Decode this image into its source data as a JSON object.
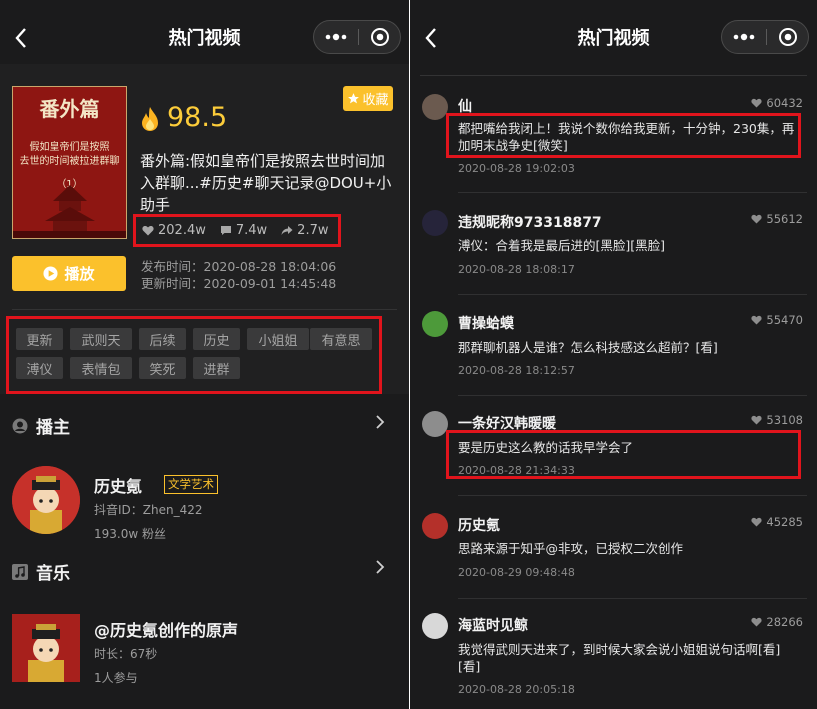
{
  "left": {
    "nav_title": "热门视频",
    "cover_text": {
      "title": "番外篇",
      "line1": "假如皇帝们是按照",
      "line2": "去世的时间被拉进群聊",
      "line3": "（1）"
    },
    "score": "98.5",
    "favorite_label": "收藏",
    "video_title": "番外篇:假如皇帝们是按照去世时间加入群聊...#历史#聊天记录@DOU+小助手",
    "stats": {
      "likes": "202.4w",
      "comments": "7.4w",
      "shares": "2.7w"
    },
    "play_label": "播放",
    "publish_time": "发布时间：2020-08-28 18:04:06",
    "update_time": "更新时间：2020-09-01 14:45:48",
    "tags": [
      "更新",
      "武则天",
      "后续",
      "历史",
      "小姐姐",
      "有意思",
      "溥仪",
      "表情包",
      "笑死",
      "进群"
    ],
    "anchor_section": "播主",
    "anchor": {
      "name": "历史氪",
      "badge": "文学艺术",
      "douyin_id": "抖音ID：Zhen_422",
      "fans": "193.0w 粉丝"
    },
    "music_section": "音乐",
    "music": {
      "title": "@历史氪创作的原声",
      "duration": "时长：67秒",
      "participants": "1人参与"
    }
  },
  "right": {
    "nav_title": "热门视频",
    "comments": [
      {
        "name": "仙",
        "likes": "60432",
        "text": "都把嘴给我闭上！我说个数你给我更新，十分钟，230集，再加明末战争史[微笑]",
        "date": "2020-08-28 19:02:03"
      },
      {
        "name": "违规昵称973318877",
        "likes": "55612",
        "text": "溥仪：合着我是最后进的[黑脸][黑脸]",
        "date": "2020-08-28 18:08:17"
      },
      {
        "name": "曹操蛤蟆",
        "likes": "55470",
        "text": "那群聊机器人是谁？怎么科技感这么超前？[看]",
        "date": "2020-08-28 18:12:57"
      },
      {
        "name": "一条好汉韩暖暖",
        "likes": "53108",
        "text": "要是历史这么教的话我早学会了",
        "date": "2020-08-28 21:34:33"
      },
      {
        "name": "历史氪",
        "likes": "45285",
        "text": "思路来源于知乎@非攻，已授权二次创作",
        "date": "2020-08-29 09:48:48"
      },
      {
        "name": "海蓝时见鲸",
        "likes": "28266",
        "text": "我觉得武则天进来了，到时候大家会说小姐姐说句话啊[看][看]",
        "date": "2020-08-28 20:05:18"
      }
    ]
  },
  "colors": {
    "accent": "#fbc12c",
    "score": "#fccc3a",
    "highlight_box": "#e1141c",
    "background": "#1b1b1c"
  }
}
